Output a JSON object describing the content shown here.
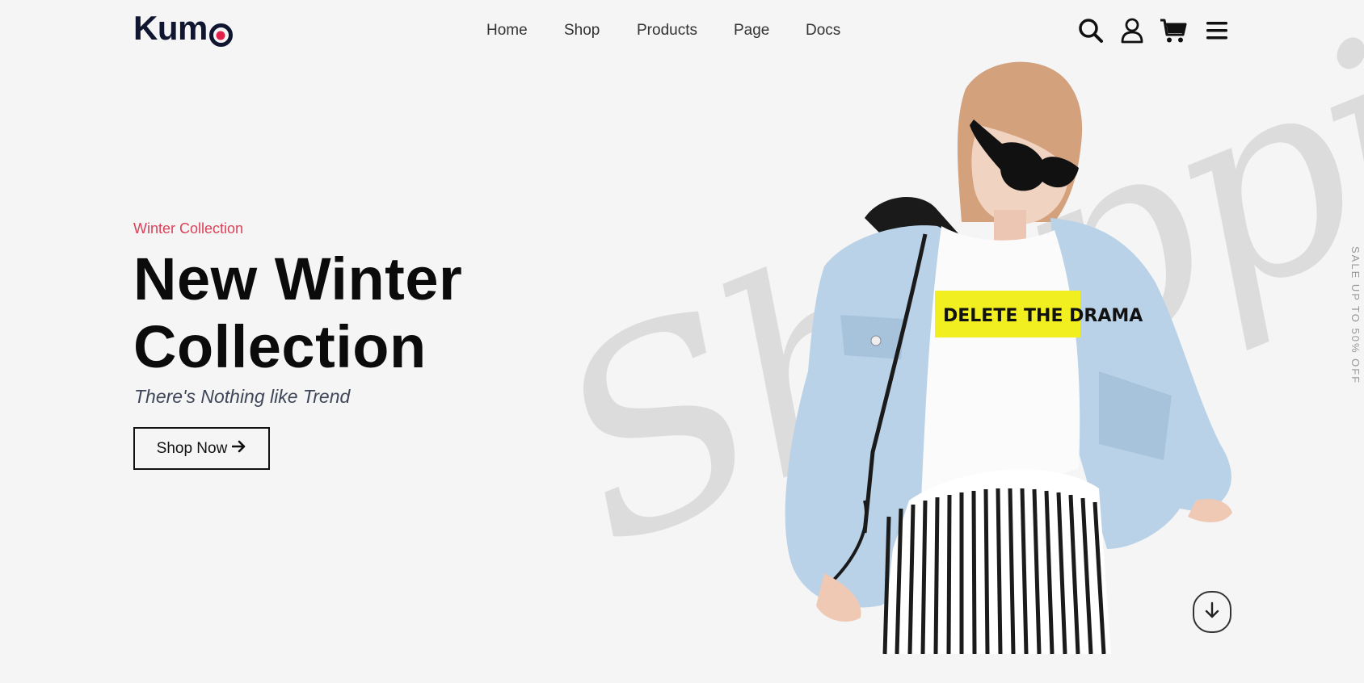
{
  "brand": {
    "name": "Kum",
    "accent": "#e2204a",
    "dark": "#10162f"
  },
  "nav": {
    "items": [
      {
        "label": "Home"
      },
      {
        "label": "Shop"
      },
      {
        "label": "Products"
      },
      {
        "label": "Page"
      },
      {
        "label": "Docs"
      }
    ]
  },
  "header_icons": [
    "search-icon",
    "user-icon",
    "cart-icon",
    "menu-icon"
  ],
  "hero": {
    "eyebrow": "Winter Collection",
    "title_line1": "New Winter",
    "title_line2": "Collection",
    "tagline": "There's Nothing like Trend",
    "cta_label": "Shop Now",
    "watermark": "Shopping",
    "tee_print": "DELETE THE DRAMA",
    "side_text": "SALE UP TO 50% OFF"
  },
  "colors": {
    "eyebrow": "#d9435a",
    "background": "#f5f5f5",
    "tee_stripe": "#f1ef1f",
    "jacket": "#b9d2e8"
  }
}
